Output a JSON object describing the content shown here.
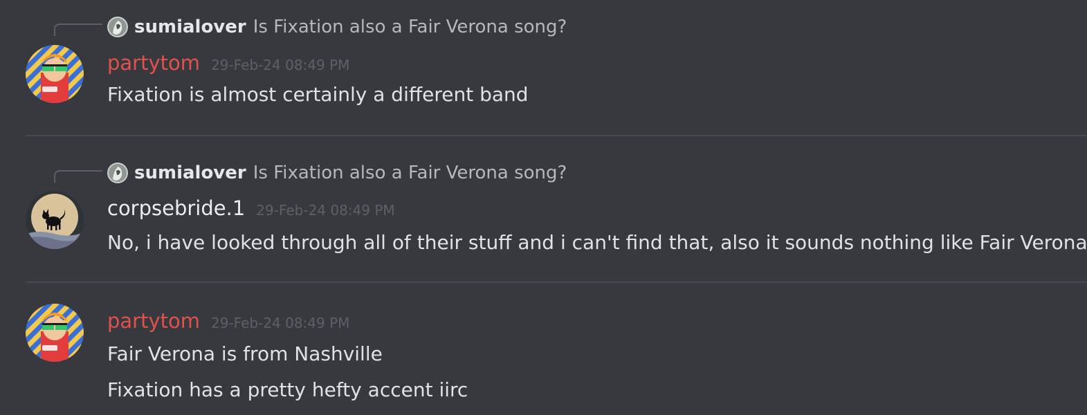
{
  "messages": [
    {
      "reply": {
        "author": "sumialover",
        "text": "Is Fixation also a Fair Verona song?"
      },
      "author": "partytom",
      "timestamp": "29-Feb-24 08:49 PM",
      "lines": [
        "Fixation is almost certainly a different band"
      ]
    },
    {
      "reply": {
        "author": "sumialover",
        "text": "Is Fixation also a Fair Verona song?"
      },
      "author": "corpsebride.1",
      "timestamp": "29-Feb-24 08:49 PM",
      "lines": [
        "No, i have looked through all of their stuff and i can't find that, also it sounds nothing like Fair Verona"
      ]
    },
    {
      "author": "partytom",
      "timestamp": "29-Feb-24 08:49 PM",
      "lines": [
        "Fair Verona is from Nashville",
        "Fixation has a pretty hefty accent iirc"
      ]
    }
  ],
  "colors": {
    "background": "#37393e",
    "partytom_name": "#e0524b",
    "corpsebride_name": "#ebecee",
    "text": "#e1e2e5",
    "timestamp": "#5d6066",
    "divider": "#45484e"
  },
  "avatars": {
    "partytom": "partytom-avatar",
    "corpsebride": "black-cat-avatar",
    "sumialover": "sumialover-avatar"
  }
}
